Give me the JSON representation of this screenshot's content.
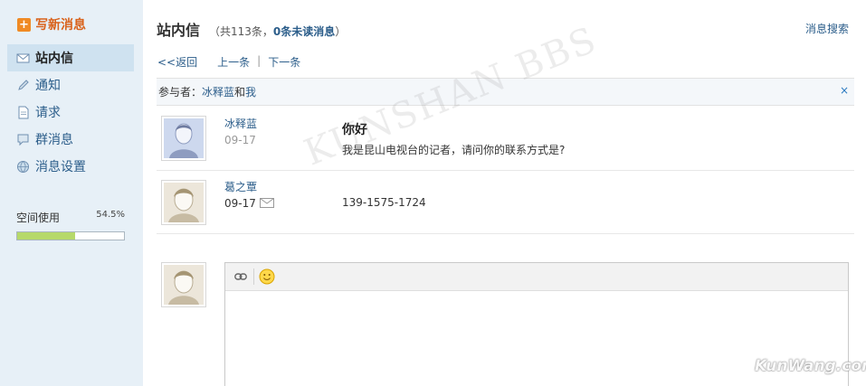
{
  "sidebar": {
    "compose_label": "写新消息",
    "items": [
      {
        "label": "站内信",
        "icon": "envelope-icon"
      },
      {
        "label": "通知",
        "icon": "pencil-icon"
      },
      {
        "label": "请求",
        "icon": "document-icon"
      },
      {
        "label": "群消息",
        "icon": "chat-bubble-icon"
      },
      {
        "label": "消息设置",
        "icon": "globe-icon"
      }
    ],
    "quota": {
      "label": "空间使用",
      "percent_text": "54.5%",
      "percent": 54.5
    }
  },
  "header": {
    "title": "站内信",
    "meta_prefix": "（共113条，",
    "unread": "0条未读消息",
    "meta_suffix": "）",
    "search_link": "消息搜索"
  },
  "nav": {
    "back": "<<返回",
    "prev": "上一条",
    "sep": "|",
    "next": "下一条"
  },
  "participants": {
    "prefix": "参与者：",
    "user1": "冰释蓝",
    "and": " 和 ",
    "user2": "我",
    "close": "×"
  },
  "messages": [
    {
      "sender": "冰释蓝",
      "date": "09-17",
      "subject": "你好",
      "body": "我是昆山电视台的记者，请问你的联系方式是?"
    },
    {
      "sender": "葛之覃",
      "date": "09-17",
      "subject": "",
      "body": "139-1575-1724"
    }
  ],
  "watermark": "KUNSHAN BBS",
  "logo": "KunWang.com",
  "colors": {
    "link": "#2b5d8a",
    "compose": "#d9621b",
    "sidebar_bg": "#e7f0f7",
    "quota_fill": "#b6d96a"
  }
}
